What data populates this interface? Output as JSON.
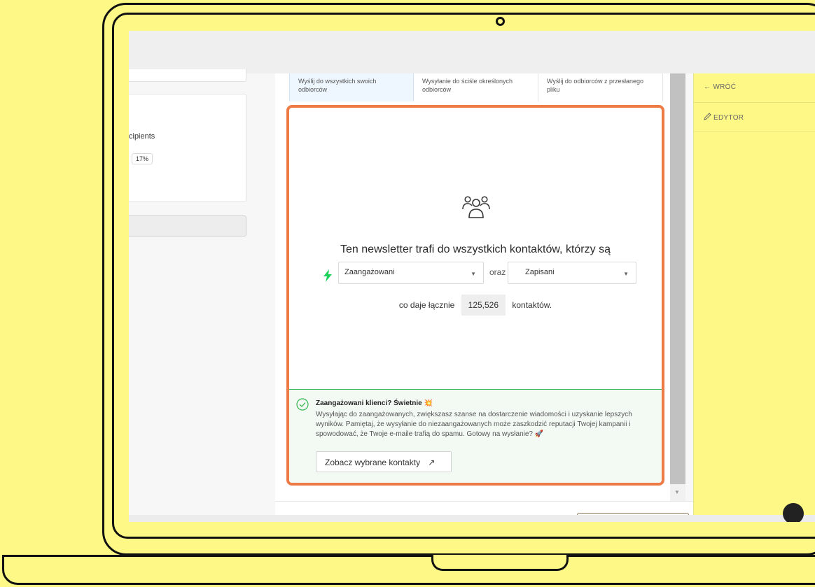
{
  "left_panel": {
    "recipients_text": "cipients",
    "percent_badge": "17%"
  },
  "tabs": [
    {
      "label": "Wyślij do wszystkich swoich odbiorców",
      "active": true
    },
    {
      "label": "Wysyłanie do ściśle określonych odbiorców",
      "active": false
    },
    {
      "label": "Wyślij do odbiorców z przesłanego pliku",
      "active": false
    }
  ],
  "main": {
    "icon": "people-group-icon",
    "headline": "Ten newsletter trafi do wszystkich kontaktów, którzy są",
    "engaged_select": {
      "value": "Zaangażowani",
      "icon": "lightning-bolt-icon"
    },
    "conjunction": "oraz",
    "subscribed_select": {
      "value": "Zapisani",
      "icon": "green-status-dot"
    },
    "total_prefix": "co daje łącznie",
    "total_value": "125,526",
    "total_suffix": "kontaktów."
  },
  "info": {
    "title": "Zaangażowani klienci? Świetnie",
    "title_emoji": "💥",
    "body": "Wysyłając do zaangażowanych, zwiększasz szanse na dostarczenie wiadomości i uzyskanie lepszych wyników. Pamiętaj, że wysyłanie do niezaangażowanych może zaszkodzić reputacji Twojej kampanii i spowodować, że Twoje e-maile trafią do spamu. Gotowy na wysłanie?",
    "body_emoji": "🚀",
    "button_label": "Zobacz wybrane kontakty",
    "button_arrow": "↗"
  },
  "right_panel": {
    "back_label": "← WRÓĆ",
    "editor_label": "EDYTOR"
  },
  "colors": {
    "background": "#fef887",
    "highlight_border": "#ee7a45",
    "accent_green": "#1ed15a"
  }
}
